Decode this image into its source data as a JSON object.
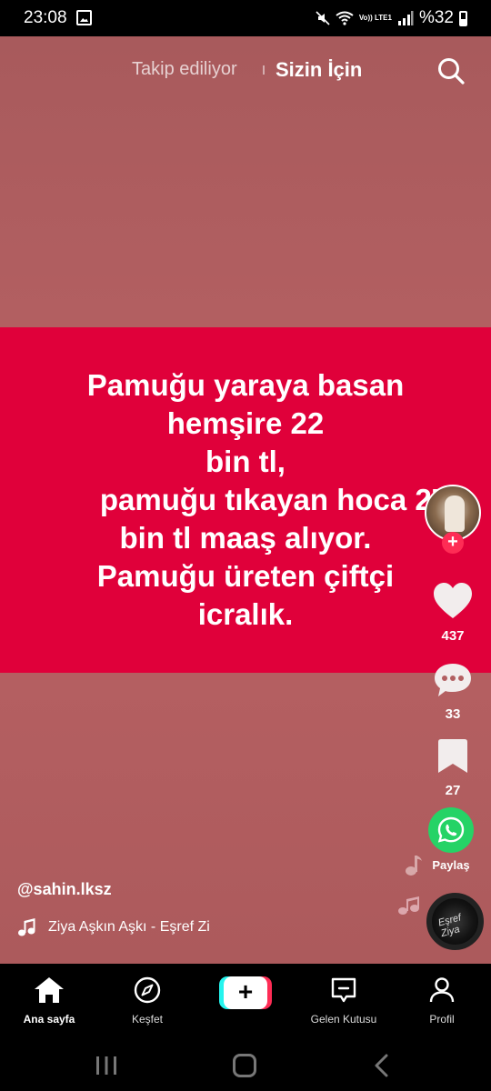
{
  "status_bar": {
    "time": "23:08",
    "network_label": "Vo)) LTE1",
    "battery": "%32"
  },
  "top_tabs": {
    "following": "Takip ediliyor",
    "for_you": "Sizin İçin",
    "search_icon": "search-icon"
  },
  "post": {
    "caption_lines": [
      "Pamuğu yaraya basan",
      "hemşire 22",
      "bin tl,",
      "pamuğu tıkayan hoca 27",
      "bin tl maaş alıyor.",
      "Pamuğu üreten çiftçi",
      "icralık."
    ],
    "username": "@sahin.lksz",
    "sound": "Ziya    Aşkın Aşkı - Eşref Zi",
    "disc_label": "Eşref Ziya"
  },
  "actions": {
    "likes": "437",
    "comments": "33",
    "saves": "27",
    "share_label": "Paylaş"
  },
  "bottom_nav": {
    "home": "Ana sayfa",
    "discover": "Keşfet",
    "create": "+",
    "inbox": "Gelen Kutusu",
    "profile": "Profil"
  },
  "colors": {
    "background": "#b25f61",
    "caption_band": "#e0003a",
    "accent": "#fe2c55",
    "whatsapp": "#25d366"
  }
}
